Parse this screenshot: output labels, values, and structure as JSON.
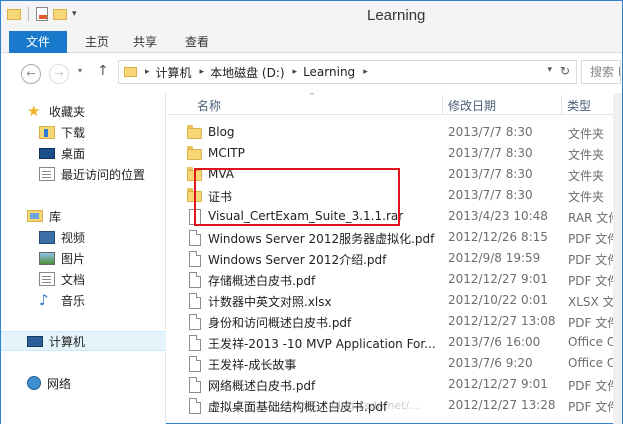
{
  "window": {
    "title": "Learning"
  },
  "ribbon": {
    "tabs": [
      "文件",
      "主页",
      "共享",
      "查看"
    ]
  },
  "address": {
    "breadcrumbs": [
      "计算机",
      "本地磁盘 (D:)",
      "Learning"
    ],
    "search_placeholder": "搜索 L"
  },
  "nav": {
    "favorites": {
      "label": "收藏夹",
      "items": [
        "下载",
        "桌面",
        "最近访问的位置"
      ]
    },
    "library": {
      "label": "库",
      "items": [
        "视频",
        "图片",
        "文档",
        "音乐"
      ]
    },
    "computer": "计算机",
    "network": "网络"
  },
  "columns": {
    "name": "名称",
    "date": "修改日期",
    "type": "类型"
  },
  "files": [
    {
      "name": "Blog",
      "date": "2013/7/7 8:30",
      "type": "文件夹",
      "icon": "folder-icon"
    },
    {
      "name": "MCITP",
      "date": "2013/7/7 8:30",
      "type": "文件夹",
      "icon": "folder-icon"
    },
    {
      "name": "MVA",
      "date": "2013/7/7 8:30",
      "type": "文件夹",
      "icon": "folder-icon"
    },
    {
      "name": "证书",
      "date": "2013/7/7 8:30",
      "type": "文件夹",
      "icon": "folder-icon"
    },
    {
      "name": "Visual_CertExam_Suite_3.1.1.rar",
      "date": "2013/4/23 10:48",
      "type": "RAR 文件",
      "icon": "rar-icon"
    },
    {
      "name": "Windows Server 2012服务器虚拟化.pdf",
      "date": "2012/12/26 8:15",
      "type": "PDF 文件",
      "icon": "document-icon"
    },
    {
      "name": "Windows Server 2012介绍.pdf",
      "date": "2012/9/8 19:59",
      "type": "PDF 文件",
      "icon": "document-icon"
    },
    {
      "name": "存储概述白皮书.pdf",
      "date": "2012/12/27 9:01",
      "type": "PDF 文件",
      "icon": "document-icon"
    },
    {
      "name": "计数器中英文对照.xlsx",
      "date": "2012/10/22 0:01",
      "type": "XLSX 文件",
      "icon": "document-icon"
    },
    {
      "name": "身份和访问概述白皮书.pdf",
      "date": "2012/12/27 13:08",
      "type": "PDF 文件",
      "icon": "document-icon"
    },
    {
      "name": "王发祥-2013 -10 MVP Application For...",
      "date": "2013/7/6 16:00",
      "type": "Office Op",
      "icon": "document-icon"
    },
    {
      "name": "王发祥-成长故事",
      "date": "2013/7/6 9:20",
      "type": "Office Op",
      "icon": "document-icon"
    },
    {
      "name": "网络概述白皮书.pdf",
      "date": "2012/12/27 9:01",
      "type": "PDF 文件",
      "icon": "document-icon"
    },
    {
      "name": "虚拟桌面基础结构概述白皮书.pdf",
      "date": "2012/12/27 13:28",
      "type": "PDF 文件",
      "icon": "document-icon"
    }
  ],
  "watermark": "blog.csdn.net/...",
  "colors": {
    "accent": "#1979ca",
    "highlight_box": "#e0141e",
    "folder": "#f7d675"
  }
}
